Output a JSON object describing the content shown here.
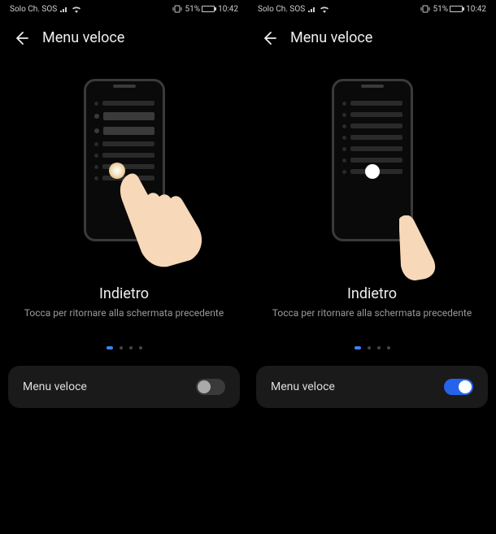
{
  "status": {
    "carrier": "Solo Ch. SOS",
    "battery": "51%",
    "time": "10:42"
  },
  "header": {
    "title": "Menu veloce"
  },
  "feature": {
    "title": "Indietro",
    "desc": "Tocca per ritornare alla schermata precedente"
  },
  "toggle": {
    "label": "Menu veloce"
  },
  "colors": {
    "accent": "#2563eb"
  }
}
